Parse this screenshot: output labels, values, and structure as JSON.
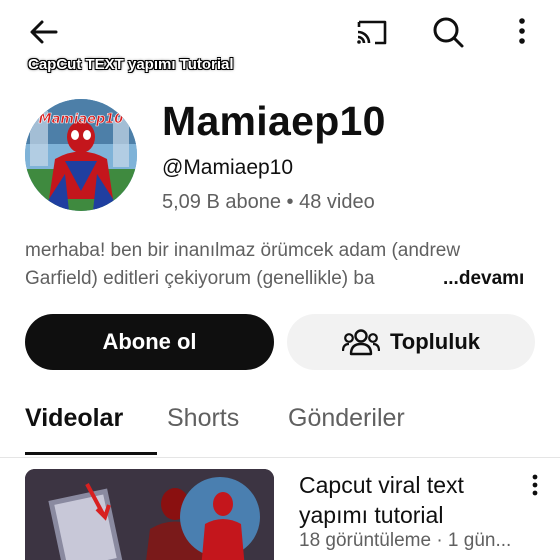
{
  "topbar": {
    "icons": [
      "arrow-left-icon",
      "cast-icon",
      "search-icon",
      "more-vertical-icon"
    ]
  },
  "channel": {
    "name": "Mamiaep10",
    "handle": "@Mamiaep10",
    "stats": "5,09 B abone • 48 video",
    "avatar_text": "Mamiaep10",
    "description_line1": "merhaba! ben bir inanılmaz örümcek adam (andrew",
    "description_line2": "Garfield) editleri çekiyorum (genellikle) ba",
    "more_label": "...devamı"
  },
  "buttons": {
    "subscribe": "Abone ol",
    "community": "Topluluk"
  },
  "tabs": [
    {
      "label": "Videolar",
      "active": true
    },
    {
      "label": "Shorts",
      "active": false
    },
    {
      "label": "Gönderiler",
      "active": false
    }
  ],
  "videos": [
    {
      "thumbnail_caption": "CapCut TEXT yapımı Tutorial",
      "title": "Capcut viral text yapımı tutorial",
      "meta": "18 görüntüleme · 1 gün..."
    }
  ],
  "colors": {
    "text_primary": "#0f0f0f",
    "text_secondary": "#606060",
    "subscribe_bg": "#0f0f0f",
    "community_bg": "#f2f2f2"
  }
}
